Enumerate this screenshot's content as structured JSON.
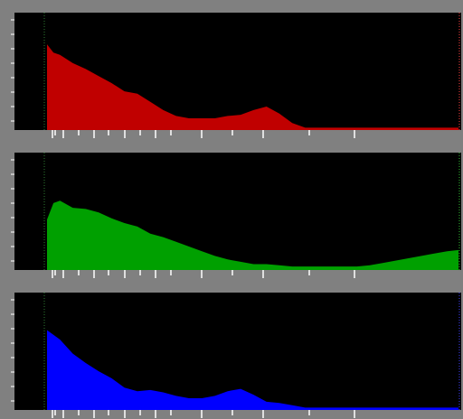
{
  "colors": {
    "background": "#808080",
    "plot_bg": "#000000",
    "red": "#c00000",
    "green": "#00a000",
    "blue": "#0000ff",
    "marker_left": "#2e7d32",
    "marker_right_red": "#ff4040",
    "marker_right_green": "#30c030",
    "marker_right_blue": "#4040ff"
  },
  "channels": [
    {
      "name": "red",
      "color": "#c00000"
    },
    {
      "name": "green",
      "color": "#00a000"
    },
    {
      "name": "blue",
      "color": "#0000ff"
    }
  ],
  "chart_data": [
    {
      "type": "area",
      "x": [
        0,
        4,
        8,
        16,
        24,
        32,
        40,
        48,
        56,
        64,
        72,
        80,
        88,
        96,
        104,
        112,
        120,
        128,
        136,
        144,
        152,
        160,
        168,
        176,
        184,
        192,
        200,
        208,
        216,
        224,
        232,
        240,
        248,
        255
      ],
      "series": [
        {
          "values": [
            0.73,
            0.66,
            0.64,
            0.57,
            0.52,
            0.46,
            0.4,
            0.33,
            0.31,
            0.24,
            0.17,
            0.12,
            0.1,
            0.1,
            0.1,
            0.12,
            0.13,
            0.17,
            0.2,
            0.14,
            0.06,
            0.02,
            0.02,
            0.02,
            0.02,
            0.02,
            0.02,
            0.02,
            0.02,
            0.02,
            0.02,
            0.02,
            0.02,
            0.02
          ]
        }
      ],
      "xlim": [
        0,
        255
      ],
      "ylim": [
        0,
        1
      ]
    },
    {
      "type": "area",
      "x": [
        0,
        4,
        8,
        16,
        24,
        32,
        40,
        48,
        56,
        64,
        72,
        80,
        88,
        96,
        104,
        112,
        120,
        128,
        136,
        144,
        152,
        160,
        168,
        176,
        184,
        192,
        200,
        208,
        216,
        224,
        232,
        240,
        248,
        255
      ],
      "series": [
        {
          "values": [
            0.43,
            0.57,
            0.59,
            0.53,
            0.52,
            0.49,
            0.44,
            0.4,
            0.37,
            0.31,
            0.28,
            0.24,
            0.2,
            0.16,
            0.12,
            0.09,
            0.07,
            0.05,
            0.05,
            0.04,
            0.03,
            0.03,
            0.03,
            0.03,
            0.03,
            0.03,
            0.04,
            0.06,
            0.08,
            0.1,
            0.12,
            0.14,
            0.16,
            0.17
          ]
        }
      ],
      "xlim": [
        0,
        255
      ],
      "ylim": [
        0,
        1
      ]
    },
    {
      "type": "area",
      "x": [
        0,
        4,
        8,
        16,
        24,
        32,
        40,
        48,
        56,
        64,
        72,
        80,
        88,
        96,
        104,
        112,
        120,
        128,
        136,
        144,
        152,
        160,
        168,
        176,
        184,
        192,
        200,
        208,
        216,
        224,
        232,
        240,
        248,
        255
      ],
      "series": [
        {
          "values": [
            0.68,
            0.64,
            0.6,
            0.48,
            0.4,
            0.33,
            0.27,
            0.19,
            0.16,
            0.17,
            0.15,
            0.12,
            0.1,
            0.1,
            0.12,
            0.16,
            0.18,
            0.13,
            0.07,
            0.06,
            0.04,
            0.02,
            0.02,
            0.02,
            0.02,
            0.02,
            0.02,
            0.02,
            0.02,
            0.02,
            0.02,
            0.02,
            0.02,
            0.02
          ]
        }
      ],
      "xlim": [
        0,
        255
      ],
      "ylim": [
        0,
        1
      ]
    }
  ],
  "markers": {
    "low": 0,
    "high": 255
  },
  "ruler_ticks": [
    6,
    9,
    18,
    35,
    52,
    68,
    86,
    103,
    120,
    137,
    171,
    205,
    239,
    290,
    340
  ]
}
